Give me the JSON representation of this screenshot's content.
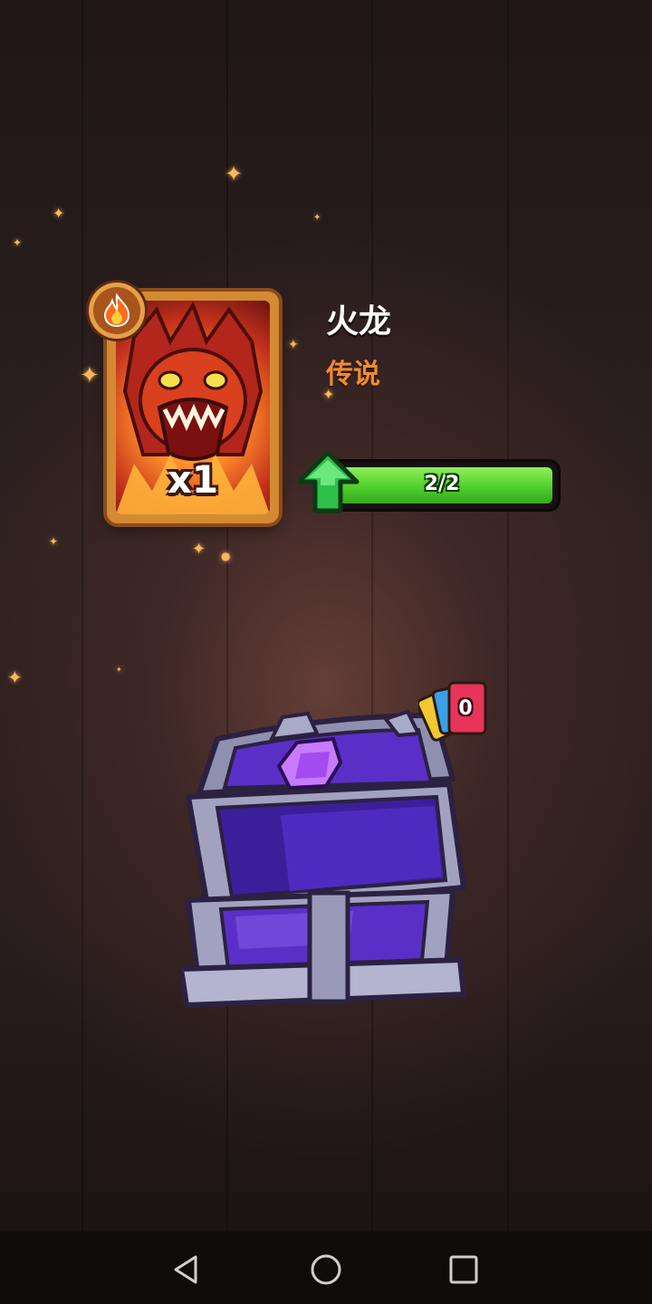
{
  "reward": {
    "card_name": "火龙",
    "rarity": "传说",
    "quantity": "x1",
    "element_icon": "fire-icon",
    "progress_text": "2/2",
    "progress_fraction": 1.0,
    "upgrade_icon": "green-up-arrow-icon"
  },
  "chest": {
    "remaining_cards": "0",
    "chest_icon": "purple-chest-icon"
  },
  "navbar": {
    "back_icon": "back-triangle-icon",
    "home_icon": "home-circle-icon",
    "recents_icon": "recents-square-icon"
  },
  "colors": {
    "rarity_color": "#f08a2e",
    "progress_green": "#4fcf2c",
    "chest_purple": "#5a2fc8",
    "card_frame": "#d48a33"
  }
}
